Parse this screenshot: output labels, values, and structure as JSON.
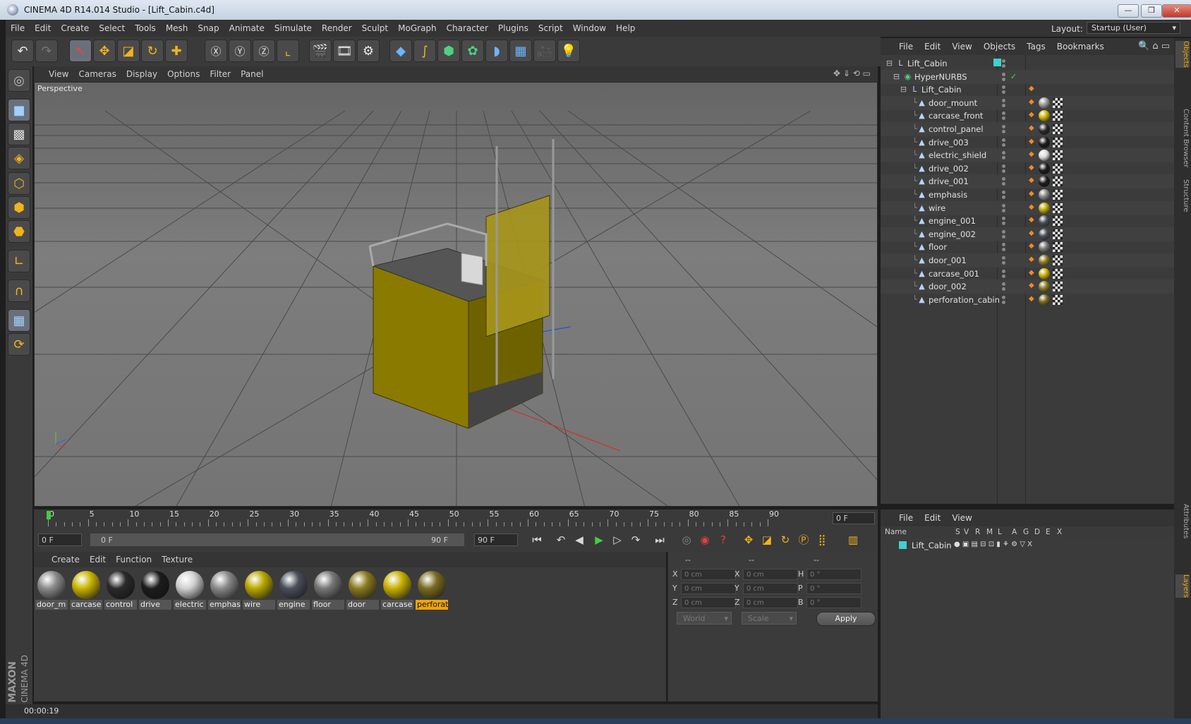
{
  "window": {
    "title": "CINEMA 4D R14.014 Studio - [Lift_Cabin.c4d]",
    "min": "—",
    "max": "❐",
    "close": "✕"
  },
  "menu": [
    "File",
    "Edit",
    "Create",
    "Select",
    "Tools",
    "Mesh",
    "Snap",
    "Animate",
    "Simulate",
    "Render",
    "Sculpt",
    "MoGraph",
    "Character",
    "Plugins",
    "Script",
    "Window",
    "Help"
  ],
  "layout": {
    "label": "Layout:",
    "value": "Startup (User)"
  },
  "viewport": {
    "menu": [
      "View",
      "Cameras",
      "Display",
      "Options",
      "Filter",
      "Panel"
    ],
    "label": "Perspective"
  },
  "timeline": {
    "ticks": [
      "0",
      "5",
      "10",
      "15",
      "20",
      "25",
      "30",
      "35",
      "40",
      "45",
      "50",
      "55",
      "60",
      "65",
      "70",
      "75",
      "80",
      "85",
      "90"
    ],
    "current_frame": "0 F"
  },
  "transport": {
    "start": "0 F",
    "range_start": "0 F",
    "range_end": "90 F",
    "end": "90 F"
  },
  "materials": {
    "menu": [
      "Create",
      "Edit",
      "Function",
      "Texture"
    ],
    "items": [
      {
        "label": "door_m",
        "color": "#8a8a8a"
      },
      {
        "label": "carcase",
        "color": "#c9b400"
      },
      {
        "label": "control",
        "color": "#2a2a2a"
      },
      {
        "label": "drive",
        "color": "#1c1c1c"
      },
      {
        "label": "electric",
        "color": "#d0d0d0"
      },
      {
        "label": "emphas",
        "color": "#888888"
      },
      {
        "label": "wire",
        "color": "#b8a800"
      },
      {
        "label": "engine",
        "color": "#4a4f5a"
      },
      {
        "label": "floor",
        "color": "#777777"
      },
      {
        "label": "door",
        "color": "#8a7a20"
      },
      {
        "label": "carcase",
        "color": "#c8b000"
      },
      {
        "label": "perforat",
        "color": "#7a6a20"
      }
    ]
  },
  "coords": {
    "header": [
      "--",
      "--",
      "--"
    ],
    "rows": [
      {
        "a": "X",
        "av": "0 cm",
        "b": "X",
        "bv": "0 cm",
        "c": "H",
        "cv": "0 °"
      },
      {
        "a": "Y",
        "av": "0 cm",
        "b": "Y",
        "bv": "0 cm",
        "c": "P",
        "cv": "0 °"
      },
      {
        "a": "Z",
        "av": "0 cm",
        "b": "Z",
        "bv": "0 cm",
        "c": "B",
        "cv": "0 °"
      }
    ],
    "world": "World",
    "scale": "Scale",
    "apply": "Apply"
  },
  "status": "00:00:19",
  "objects": {
    "menu": [
      "File",
      "Edit",
      "View",
      "Objects",
      "Tags",
      "Bookmarks"
    ],
    "tree": [
      {
        "name": "Lift_Cabin",
        "level": 0,
        "icon": "null-icon"
      },
      {
        "name": "HyperNURBS",
        "level": 1,
        "icon": "hypernurbs-icon"
      },
      {
        "name": "Lift_Cabin",
        "level": 2,
        "icon": "null-icon"
      },
      {
        "name": "door_mount",
        "level": 3,
        "icon": "polygon-icon",
        "mat": "#9a9a9a"
      },
      {
        "name": "carcase_front",
        "level": 3,
        "icon": "polygon-icon",
        "mat": "#c9b400"
      },
      {
        "name": "control_panel",
        "level": 3,
        "icon": "polygon-icon",
        "mat": "#2a2a2a"
      },
      {
        "name": "drive_003",
        "level": 3,
        "icon": "polygon-icon",
        "mat": "#1c1c1c"
      },
      {
        "name": "electric_shield",
        "level": 3,
        "icon": "polygon-icon",
        "mat": "#dcdcdc"
      },
      {
        "name": "drive_002",
        "level": 3,
        "icon": "polygon-icon",
        "mat": "#1c1c1c"
      },
      {
        "name": "drive_001",
        "level": 3,
        "icon": "polygon-icon",
        "mat": "#1c1c1c"
      },
      {
        "name": "emphasis",
        "level": 3,
        "icon": "polygon-icon",
        "mat": "#888888"
      },
      {
        "name": "wire",
        "level": 3,
        "icon": "polygon-icon",
        "mat": "#b8a800"
      },
      {
        "name": "engine_001",
        "level": 3,
        "icon": "polygon-icon",
        "mat": "#4a4f5a"
      },
      {
        "name": "engine_002",
        "level": 3,
        "icon": "polygon-icon",
        "mat": "#4a4f5a"
      },
      {
        "name": "floor",
        "level": 3,
        "icon": "polygon-icon",
        "mat": "#777777"
      },
      {
        "name": "door_001",
        "level": 3,
        "icon": "polygon-icon",
        "mat": "#8a7a20"
      },
      {
        "name": "carcase_001",
        "level": 3,
        "icon": "polygon-icon",
        "mat": "#c8b000"
      },
      {
        "name": "door_002",
        "level": 3,
        "icon": "polygon-icon",
        "mat": "#8a7a20"
      },
      {
        "name": "perforation_cabin",
        "level": 3,
        "icon": "polygon-icon",
        "mat": "#7a6a20"
      }
    ]
  },
  "layers": {
    "menu": [
      "File",
      "Edit",
      "View"
    ],
    "columns": [
      "Name",
      "S",
      "V",
      "R",
      "M",
      "L",
      "A",
      "G",
      "D",
      "E",
      "X"
    ],
    "rows": [
      {
        "name": "Lift_Cabin",
        "color": "#3fd0d0"
      }
    ]
  },
  "sidetabs": [
    "Objects",
    "Content Browser",
    "Structure",
    "Attributes",
    "Layers"
  ],
  "colors": {
    "accent": "#f0a500",
    "tool_orange": "#f1b21f",
    "tool_blue": "#6cb4ff"
  }
}
